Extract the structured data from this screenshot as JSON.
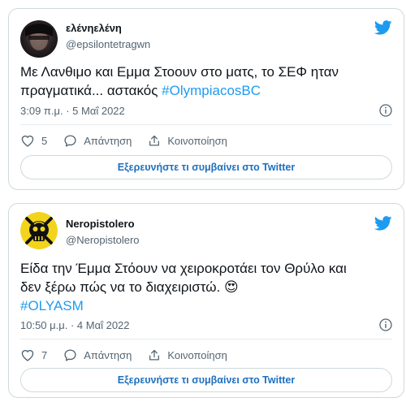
{
  "tweets": [
    {
      "author_name": "ελένηελένη",
      "author_handle": "@epsilontetragwn",
      "text": "Με Λανθιμο και Εμμα Στοουν στο ματς, το ΣΕΦ ηταν πραγματικά... αστακός ",
      "hashtag": "#OlympiacosBC",
      "timestamp": "3:09 π.μ. · 5 Μαΐ 2022",
      "like_count": "5",
      "reply_label": "Απάντηση",
      "share_label": "Κοινοποίηση",
      "explore_label": "Εξερευνήστε τι συμβαίνει στο Twitter",
      "avatar_icon": "dark-portrait-avatar"
    },
    {
      "author_name": "Neropistolero",
      "author_handle": "@Neropistolero",
      "text_line1": "Είδα την Έμμα Στόουν να χειροκροτάει τον Θρύλο και",
      "text_line2": "δεν ξέρω πώς να το διαχειριστώ. ",
      "emoji": "😍",
      "hashtag": "#OLYASM",
      "timestamp": "10:50 μ.μ. · 4 Μαΐ 2022",
      "like_count": "7",
      "reply_label": "Απάντηση",
      "share_label": "Κοινοποίηση",
      "explore_label": "Εξερευνήστε τι συμβαίνει στο Twitter",
      "avatar_icon": "jolly-roger-avatar"
    }
  ],
  "colors": {
    "accent": "#1d9bf0",
    "text_primary": "#0f1419",
    "text_secondary": "#536471",
    "border": "#cfd9de"
  }
}
